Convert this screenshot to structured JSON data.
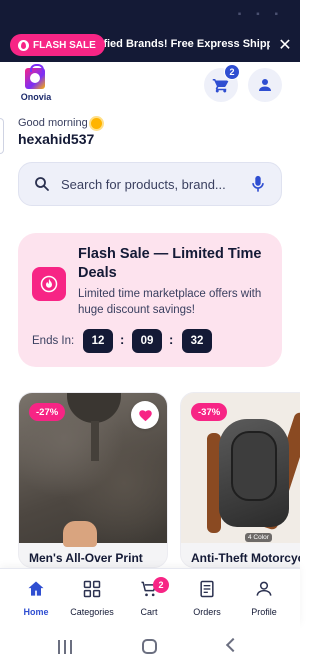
{
  "promo": {
    "badge_label": "FLASH SALE",
    "text": "rified Brands! Free Express Shipping",
    "close_glyph": "✕"
  },
  "header": {
    "logo_text": "Onovia",
    "cart_count": "2"
  },
  "greeting": {
    "text": "Good morning",
    "username": "hexahid537"
  },
  "search": {
    "placeholder": "Search for products, brand..."
  },
  "flash_sale": {
    "title": "Flash Sale — Limited Time Deals",
    "subtitle": "Limited time marketplace offers with huge discount savings!",
    "ends_label": "Ends In:",
    "hours": "12",
    "minutes": "09",
    "seconds": "32",
    "separator": ":"
  },
  "products": [
    {
      "discount": "-27%",
      "title": "Men's All-Over Print",
      "favorited": true
    },
    {
      "discount": "-37%",
      "title": "Anti-Theft Motorcycl",
      "colors_label": "4 Color"
    }
  ],
  "bottom_nav": {
    "items": [
      {
        "label": "Home",
        "icon": "home-icon",
        "active": true
      },
      {
        "label": "Categories",
        "icon": "grid-icon"
      },
      {
        "label": "Cart",
        "icon": "cart-icon",
        "badge": "2"
      },
      {
        "label": "Orders",
        "icon": "receipt-icon"
      },
      {
        "label": "Profile",
        "icon": "person-icon"
      }
    ]
  },
  "colors": {
    "accent_pink": "#f72585",
    "primary_blue": "#2f4ed1",
    "dark_navy": "#141a36",
    "flash_bg": "#fde3ee"
  }
}
